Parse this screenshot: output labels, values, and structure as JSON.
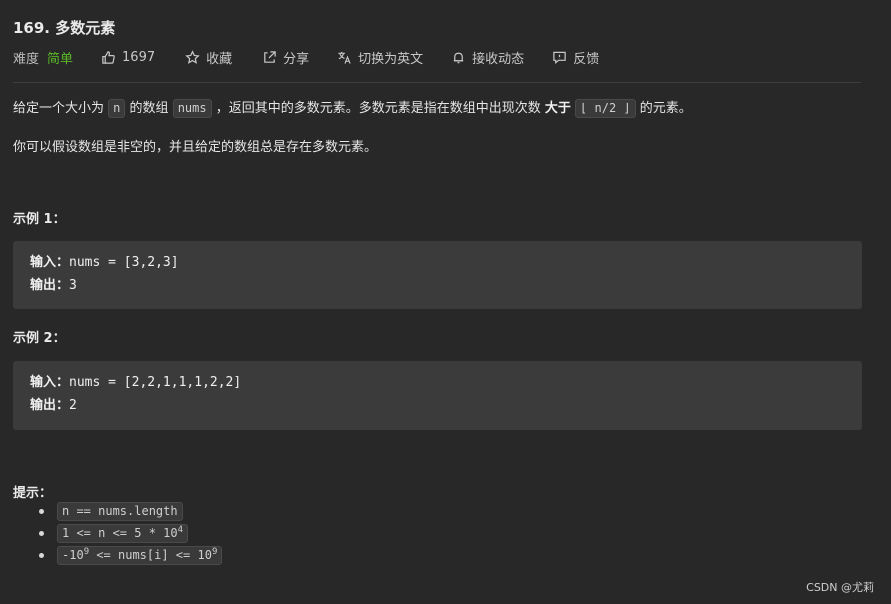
{
  "problem": {
    "title": "169. 多数元素",
    "difficulty_label": "难度",
    "difficulty_value": "简单",
    "likes": "1697",
    "actions": {
      "collect": "收藏",
      "share": "分享",
      "switch_lang": "切换为英文",
      "subscribe": "接收动态",
      "feedback": "反馈"
    }
  },
  "description": {
    "p1_a": "给定一个大小为",
    "p1_code_n": "n",
    "p1_b": "的数组",
    "p1_code_nums": "nums",
    "p1_c": "，返回其中的多数元素。多数元素是指在数组中出现次数",
    "p1_bold": "大于",
    "p1_code_floor": "⌊ n/2 ⌋",
    "p1_d": "的元素。",
    "p2": "你可以假设数组是非空的，并且给定的数组总是存在多数元素。"
  },
  "examples": [
    {
      "title": "示例 1：",
      "input_label": "输入：",
      "input_value": "nums = [3,2,3]",
      "output_label": "输出：",
      "output_value": "3"
    },
    {
      "title": "示例 2：",
      "input_label": "输入：",
      "input_value": "nums = [2,2,1,1,1,2,2]",
      "output_label": "输出：",
      "output_value": "2"
    }
  ],
  "hints": {
    "title": "提示：",
    "items": [
      {
        "text": "n == nums.length"
      },
      {
        "text_a": "1 <= n <= 5 * 10",
        "sup": "4"
      },
      {
        "text_a": "-10",
        "sup_a": "9",
        "text_b": " <= nums[i] <= 10",
        "sup_b": "9"
      }
    ]
  },
  "watermark": "CSDN @尤莉",
  "colors": {
    "background": "#282828",
    "difficulty_easy": "#5ab726",
    "example_box": "#3b3b3b"
  },
  "icons": [
    "thumbs-up-icon",
    "star-icon",
    "share-icon",
    "translate-icon",
    "bell-icon",
    "feedback-icon"
  ]
}
